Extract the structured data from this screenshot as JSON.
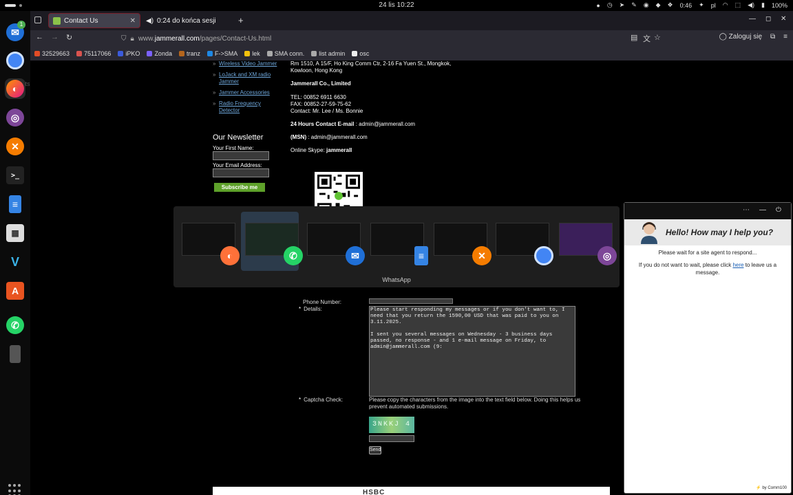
{
  "system": {
    "date_time": "24 lis  10:22",
    "battery_time": "0:46",
    "language": "pl",
    "battery": "100%"
  },
  "dock": {
    "badge_count": "1",
    "whatsapp_hover_label": "Whats"
  },
  "browser": {
    "tabs": [
      {
        "label": "Contact Us",
        "active": true
      },
      {
        "label": "0:24 do końca sesji",
        "active": false
      }
    ],
    "url_prefix": "www.",
    "url_host": "jammerall.com",
    "url_path": "/pages/Contact-Us.html",
    "signin_label": "Zaloguj się",
    "bookmarks": [
      {
        "label": "32529663",
        "color": "#e34c26"
      },
      {
        "label": "75117066",
        "color": "#d9534f"
      },
      {
        "label": "iPKO",
        "color": "#3b5bdb"
      },
      {
        "label": "Zonda",
        "color": "#7b61ff"
      },
      {
        "label": "tranz",
        "color": "#b5651d"
      },
      {
        "label": "F->SMA",
        "color": "#1e88e5"
      },
      {
        "label": "lek",
        "color": "#f4c20d"
      },
      {
        "label": "SMA conn.",
        "color": "#aaaaaa"
      },
      {
        "label": "list admin",
        "color": "#aaaaaa"
      },
      {
        "label": "osc",
        "color": "#eeeeee"
      }
    ]
  },
  "page": {
    "sidebar_links": [
      "Wireless Video Jammer",
      "LoJack and XM radio Jammer",
      "Jammer Accessories",
      "Radio Frequency Detector"
    ],
    "newsletter": {
      "title": "Our Newsletter",
      "first_name_label": "Your First Name:",
      "email_label": "Your Email Address:",
      "subscribe_label": "Subscribe me"
    },
    "contact": {
      "address": "Rm 1510, A 15/F, Ho King Comm Ctr, 2-16 Fa Yuen St., Mongkok, Kowloon, Hong Kong",
      "company": "Jammerall Co., Limited",
      "tel": "TEL: 00852 6911 6630",
      "fax": "FAX: 00852-27-59-75-62",
      "contact_person": "Contact: Mr. Lee / Ms. Bonnie",
      "email_label": "24 Hours Contact E-mail",
      "email_value": ": admin@jammerall.com",
      "msn_label": "(MSN)",
      "msn_value": ": admin@jammerall.com",
      "skype_label": "Online Skype:",
      "skype_value": "jammerall"
    },
    "form": {
      "phone_label": "Phone Number:",
      "details_label": "Details:",
      "details_value": "Please start responding my messages or if you don't want to, I need that you return the 1590,00 USD that was paid to you on 3.11.2025.\n\nI sent you several messages on Wednesday - 3 business days passed, no response - and 1 e-mail message on Friday, to admin@jammerall.com (9:",
      "captcha_label": "Captcha Check:",
      "captcha_help": "Please copy the characters from the image into the text field below. Doing this helps us prevent automated submissions.",
      "captcha_code": "3NKKJ 4",
      "send_label": "Send"
    },
    "footer_partial_text": "HSBC"
  },
  "switcher": {
    "selected_label": "WhatsApp",
    "apps": [
      {
        "name": "Firefox",
        "icon_color": "#ff7139"
      },
      {
        "name": "WhatsApp",
        "icon_color": "#25d366"
      },
      {
        "name": "Thunderbird",
        "icon_color": "#1f6fd6"
      },
      {
        "name": "Files",
        "icon_color": "#3584e4"
      },
      {
        "name": "Remmina",
        "icon_color": "#f57c00"
      },
      {
        "name": "Chromium",
        "icon_color": "#4285f4"
      },
      {
        "name": "Tor Browser",
        "icon_color": "#7d4698"
      }
    ]
  },
  "chat": {
    "title": "Hello! How may I help you?",
    "wait_msg": "Please wait for a site agent to respond...",
    "leave_pre": "If you do not want to wait, please click",
    "leave_link": "here",
    "leave_post": "to leave us a message.",
    "footer": "by Comm100"
  }
}
